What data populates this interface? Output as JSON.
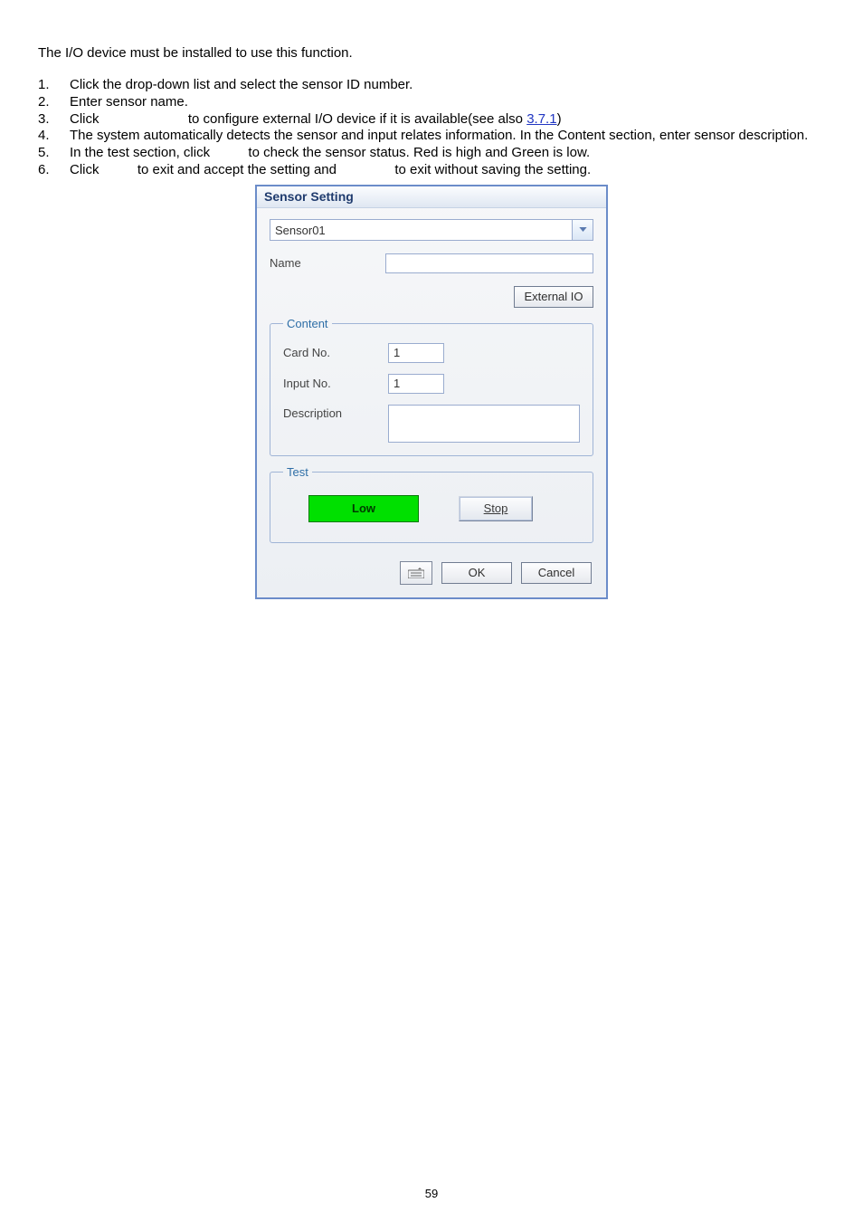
{
  "doc": {
    "intro": "The I/O device must be installed to use this function.",
    "steps": [
      {
        "n": "1.",
        "text": "Click the drop-down list and select the sensor ID number."
      },
      {
        "n": "2.",
        "text": "Enter sensor name."
      },
      {
        "n": "3.",
        "text_a": "Click ",
        "blank1": "              ",
        "text_b": " to configure external I/O device if it is available(see also ",
        "link": "3.7.1",
        "text_c": ")"
      },
      {
        "n": "4.",
        "text": "The system automatically detects the sensor and input relates information. In the Content section, enter sensor description.",
        "justify": true
      },
      {
        "n": "5.",
        "text_a": "In the test section, click ",
        "text_b": "  to check the sensor status. Red is high and Green is low."
      },
      {
        "n": "6.",
        "text_a": "Click ",
        "text_b": " to exit and accept the setting and ",
        "text_c": " to exit without saving the setting."
      }
    ],
    "page_number": "59"
  },
  "dialog": {
    "title": "Sensor Setting",
    "combo_value": "Sensor01",
    "name_label": "Name",
    "name_value": "",
    "external_io_btn": "External IO",
    "content": {
      "legend": "Content",
      "card_no_label": "Card No.",
      "card_no_value": "1",
      "input_no_label": "Input No.",
      "input_no_value": "1",
      "description_label": "Description",
      "description_value": ""
    },
    "test": {
      "legend": "Test",
      "status_text": "Low",
      "stop_btn": "Stop"
    },
    "buttons": {
      "ok": "OK",
      "cancel": "Cancel"
    }
  }
}
